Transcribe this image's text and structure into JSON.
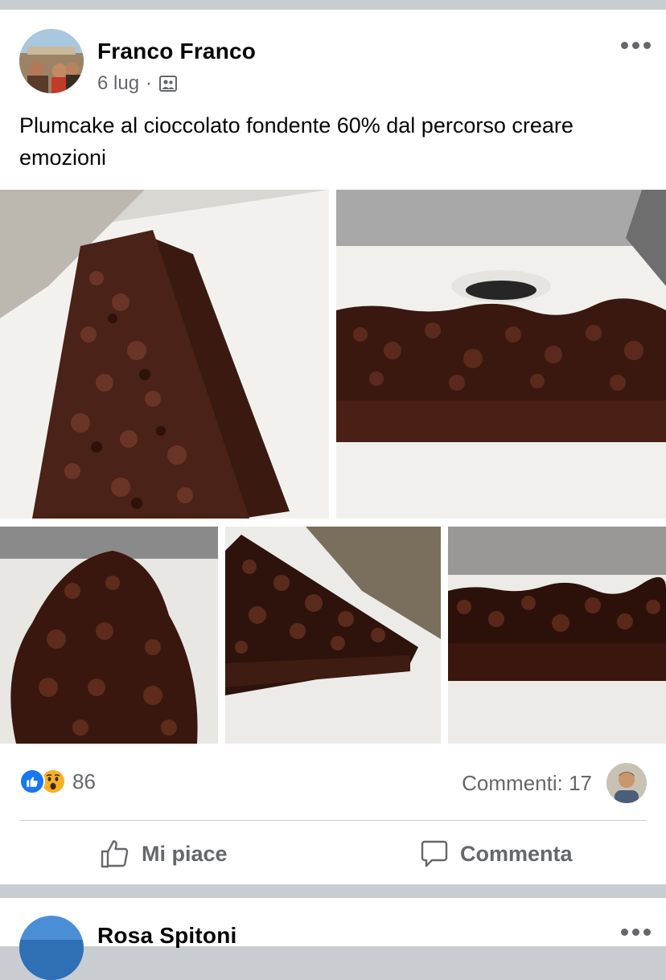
{
  "post": {
    "author": "Franco Franco",
    "date": "6 lug",
    "separator": "·",
    "audience_icon": "friends-icon",
    "text": "Plumcake al cioccolato fondente 60% dal percorso creare emozioni",
    "photo_count": 5,
    "reactions": {
      "types": [
        "like",
        "wow"
      ],
      "count": "86"
    },
    "comments_label": "Commenti: 17",
    "actions": {
      "like_label": "Mi piace",
      "comment_label": "Commenta"
    }
  },
  "next_post": {
    "author": "Rosa Spitoni"
  },
  "colors": {
    "facebook_blue": "#1877f2",
    "secondary_text": "#65676b",
    "divider": "#ced0d4",
    "feed_background": "#c9ccd1",
    "wow_yellow": "#f7b125"
  }
}
